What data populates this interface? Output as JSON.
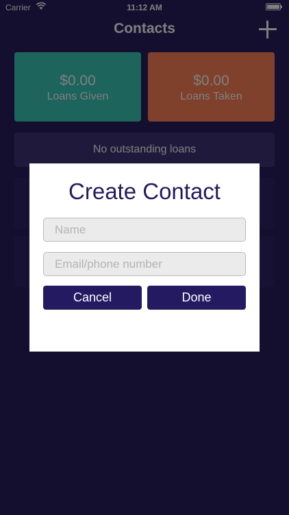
{
  "status_bar": {
    "carrier": "Carrier",
    "time": "11:12 AM"
  },
  "nav": {
    "title": "Contacts",
    "add_icon": "plus-icon"
  },
  "summary": {
    "given": {
      "amount": "$0.00",
      "label": "Loans Given",
      "color": "#3bc9b8"
    },
    "taken": {
      "amount": "$0.00",
      "label": "Loans Taken",
      "color": "#ff8258"
    }
  },
  "loans": {
    "empty_message": "No outstanding loans"
  },
  "dialog": {
    "title": "Create Contact",
    "name_field": {
      "value": "",
      "placeholder": "Name"
    },
    "contact_field": {
      "value": "",
      "placeholder": "Email/phone number"
    },
    "cancel_label": "Cancel",
    "done_label": "Done"
  },
  "colors": {
    "background": "#2a1f5e",
    "accent": "#241a62",
    "dialog_title": "#241a5e"
  }
}
